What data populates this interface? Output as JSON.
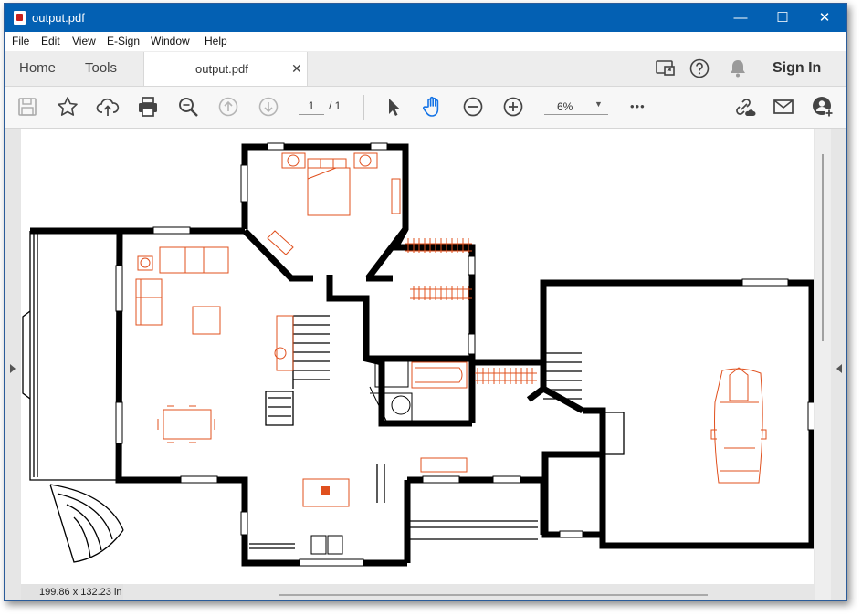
{
  "window": {
    "title": "output.pdf",
    "controls": {
      "minimize": "—",
      "maximize": "☐",
      "close": "✕"
    }
  },
  "menu": [
    "File",
    "Edit",
    "View",
    "E-Sign",
    "Window",
    "Help"
  ],
  "tabs": {
    "home": "Home",
    "tools": "Tools",
    "document": "output.pdf",
    "close": "✕"
  },
  "tabbar_right": {
    "icons": [
      "share-screen-icon",
      "help-icon",
      "bell-icon"
    ],
    "sign_in": "Sign In"
  },
  "toolbar": {
    "icons": [
      "save-icon",
      "star-icon",
      "upload-cloud-icon",
      "print-icon",
      "zoom-search-icon",
      "page-up-icon",
      "page-down-icon",
      "select-cursor-icon",
      "hand-icon",
      "zoom-out-icon",
      "zoom-in-icon",
      "more-icon",
      "link-cloud-icon",
      "mail-icon",
      "add-user-icon"
    ],
    "page_current": "1",
    "page_separator": "/ 1",
    "zoom": "6%",
    "zoom_caret": "▼",
    "more": "•••"
  },
  "document": {
    "page_size": "199.86 x 132.23 in"
  },
  "colors": {
    "titlebar": "#0360b3",
    "accent_blue": "#1473e6",
    "plan_red": "#e0501e",
    "wall": "#000000"
  }
}
